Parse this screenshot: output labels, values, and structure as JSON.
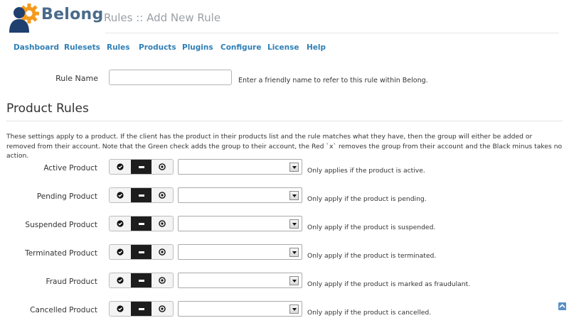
{
  "header": {
    "brand": "Belong",
    "subtitle": "Rules :: Add New Rule"
  },
  "nav": [
    "Dashboard",
    "Rulesets",
    "Rules",
    "Products",
    "Plugins",
    "Configure",
    "License",
    "Help"
  ],
  "rule_name": {
    "label": "Rule Name",
    "value": "",
    "placeholder": "",
    "hint": "Enter a friendly name to refer to this rule within Belong."
  },
  "product_rules": {
    "title": "Product Rules",
    "description": "These settings apply to a product.  If the client has the product in their products list and the rule matches what they have, then the group will either be added or removed from their account.  Note that the Green check adds the group to their account, the Red `x` removes the group from their account and the Black minus takes no action.",
    "rows": [
      {
        "label": "Active Product",
        "selected": "none",
        "select_value": "",
        "note": "Only applies if the product is active."
      },
      {
        "label": "Pending Product",
        "selected": "none",
        "select_value": "",
        "note": "Only apply if the product is pending."
      },
      {
        "label": "Suspended Product",
        "selected": "none",
        "select_value": "",
        "note": "Only apply if the product is suspended."
      },
      {
        "label": "Terminated Product",
        "selected": "none",
        "select_value": "",
        "note": "Only apply if the product is terminated."
      },
      {
        "label": "Fraud Product",
        "selected": "none",
        "select_value": "",
        "note": "Only apply if the product is marked as fraudulant."
      },
      {
        "label": "Cancelled Product",
        "selected": "none",
        "select_value": "",
        "note": "Only apply if the product is cancelled."
      }
    ]
  },
  "icons": {
    "logo": "belong-user-gear-logo",
    "add": "check-circle-icon",
    "none": "minus-icon",
    "remove": "x-circle-icon",
    "select_arrow": "chevron-down-icon",
    "scroll": "scroll-to-top-icon"
  },
  "colors": {
    "brand": "#4a6b8a",
    "link": "#2f7fb6",
    "active_toggle": "#1d1d1d"
  }
}
